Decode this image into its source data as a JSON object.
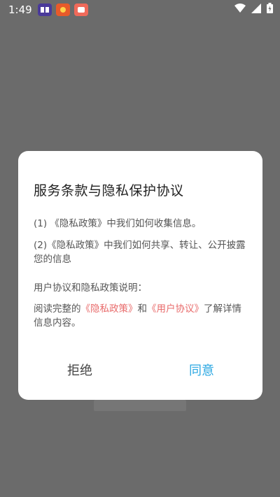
{
  "status_bar": {
    "time": "1:49",
    "notifications": [
      {
        "icon": "app-notification-icon-1",
        "color": "#4a3a9a"
      },
      {
        "icon": "app-notification-icon-2",
        "color": "#e85a2a"
      },
      {
        "icon": "app-notification-icon-3",
        "color": "#f06a5a"
      }
    ],
    "icons": [
      "wifi-icon",
      "signal-icon",
      "battery-icon"
    ]
  },
  "dialog": {
    "title": "服务条款与隐私保护协议",
    "item1": "(1) 《隐私政策》中我们如何收集信息。",
    "item2": "(2)《隐私政策》中我们如何共享、转让、公开披露您的信息",
    "explain_heading": "用户协议和隐私政策说明：",
    "read_prefix": "阅读完整的",
    "privacy_link": "《隐私政策》",
    "and_text": "和",
    "user_agreement_link": "《用户协议》",
    "read_suffix": "了解详情信息内容。",
    "refuse_button": "拒绝",
    "agree_button": "同意"
  },
  "colors": {
    "overlay": "#6b6b6b",
    "link": "#e86a6a",
    "agree": "#2aa7e2"
  }
}
